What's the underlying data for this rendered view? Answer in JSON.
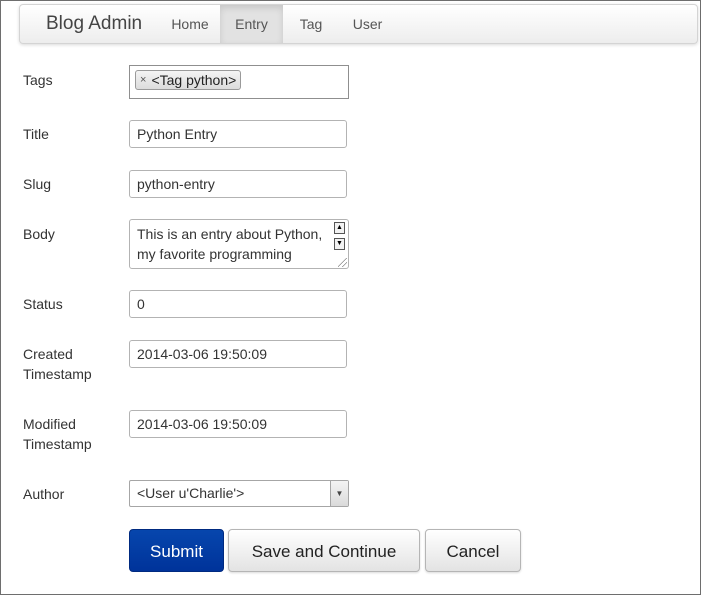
{
  "navbar": {
    "brand": "Blog Admin",
    "items": [
      "Home",
      "Entry",
      "Tag",
      "User"
    ],
    "active": "Entry"
  },
  "form": {
    "tags": {
      "label": "Tags",
      "chips": [
        "<Tag python>"
      ],
      "remove_glyph": "×"
    },
    "title": {
      "label": "Title",
      "value": "Python Entry"
    },
    "slug": {
      "label": "Slug",
      "value": "python-entry"
    },
    "body": {
      "label": "Body",
      "value": "This is an entry about Python,\nmy favorite programming"
    },
    "status": {
      "label": "Status",
      "value": "0"
    },
    "created": {
      "label_line1": "Created",
      "label_line2": "Timestamp",
      "value": "2014-03-06 19:50:09"
    },
    "modified": {
      "label_line1": "Modified",
      "label_line2": "Timestamp",
      "value": "2014-03-06 19:50:09"
    },
    "author": {
      "label": "Author",
      "selected": "<User u'Charlie'>"
    }
  },
  "actions": {
    "submit": "Submit",
    "save_continue": "Save and Continue",
    "cancel": "Cancel"
  },
  "colors": {
    "primary": "#0646ad",
    "nav_active_bg": "#e2e2e2"
  },
  "icons": {
    "tag_remove": "close-icon",
    "scroll_up": "arrow-up-icon",
    "scroll_down": "arrow-down-icon",
    "select_arrow": "chevron-down-icon",
    "resize": "resize-grip-icon"
  }
}
